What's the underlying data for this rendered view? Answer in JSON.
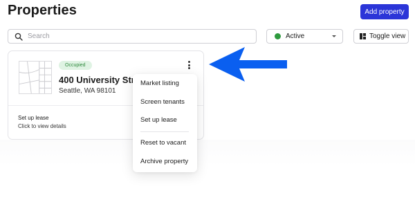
{
  "header": {
    "title": "Properties",
    "add_button": "Add property"
  },
  "toolbar": {
    "search_placeholder": "Search",
    "status_filter": {
      "label": "Active",
      "dot_color": "#2e9a3e"
    },
    "toggle_view": "Toggle view"
  },
  "property_card": {
    "status_badge": "Occupied",
    "address": "400 University Street",
    "city": "Seattle, WA 98101",
    "task": {
      "title": "Set up lease",
      "subtitle": "Click to view details"
    }
  },
  "context_menu": {
    "items": [
      {
        "label": "Market listing"
      },
      {
        "label": "Screen tenants"
      },
      {
        "label": "Set up lease"
      },
      {
        "label": "Reset to vacant"
      },
      {
        "label": "Archive property"
      }
    ]
  },
  "colors": {
    "accent": "#2b35d8",
    "annotation_arrow": "#0a5ff0",
    "badge_bg": "#dff3e3",
    "badge_text": "#2f8a3e"
  },
  "icons": [
    "search-icon",
    "chevron-down-icon",
    "grid-view-icon",
    "map-icon",
    "more-vertical-icon",
    "arrow-left-icon"
  ]
}
